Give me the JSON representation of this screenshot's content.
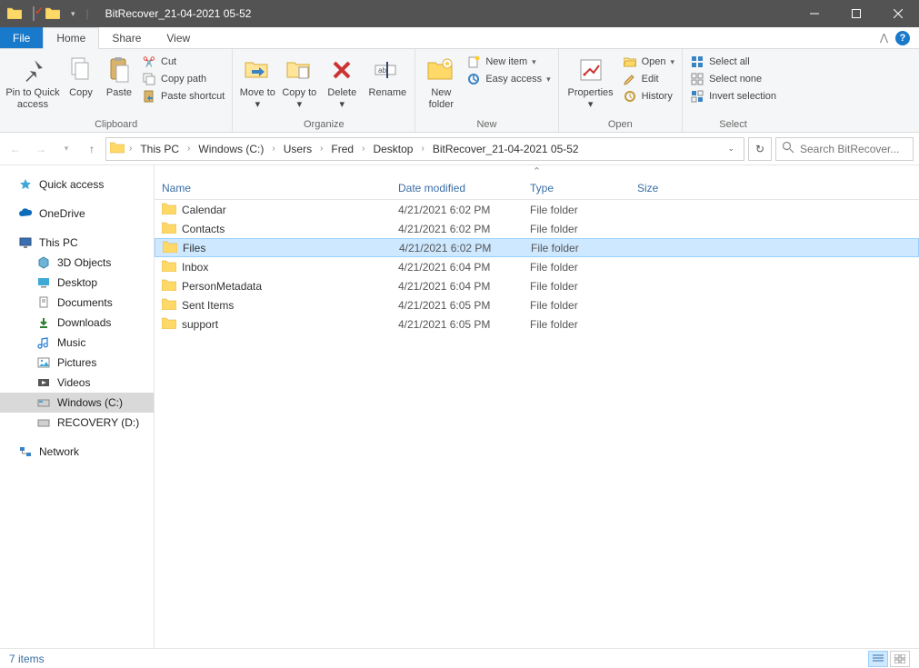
{
  "titlebar": {
    "title": "BitRecover_21-04-2021 05-52"
  },
  "tabs": {
    "file": "File",
    "home": "Home",
    "share": "Share",
    "view": "View"
  },
  "ribbon": {
    "clipboard": {
      "pin": "Pin to Quick access",
      "copy": "Copy",
      "paste": "Paste",
      "cut": "Cut",
      "copypath": "Copy path",
      "pasteshortcut": "Paste shortcut",
      "label": "Clipboard"
    },
    "organize": {
      "moveto": "Move to",
      "copyto": "Copy to",
      "delete": "Delete",
      "rename": "Rename",
      "label": "Organize"
    },
    "new": {
      "newfolder": "New folder",
      "newitem": "New item",
      "easyaccess": "Easy access",
      "label": "New"
    },
    "open": {
      "properties": "Properties",
      "open": "Open",
      "edit": "Edit",
      "history": "History",
      "label": "Open"
    },
    "select": {
      "selectall": "Select all",
      "selectnone": "Select none",
      "invert": "Invert selection",
      "label": "Select"
    }
  },
  "breadcrumbs": [
    "This PC",
    "Windows (C:)",
    "Users",
    "Fred",
    "Desktop",
    "BitRecover_21-04-2021 05-52"
  ],
  "search": {
    "placeholder": "Search BitRecover..."
  },
  "nav": {
    "quick": "Quick access",
    "onedrive": "OneDrive",
    "thispc": "This PC",
    "objects3d": "3D Objects",
    "desktop": "Desktop",
    "documents": "Documents",
    "downloads": "Downloads",
    "music": "Music",
    "pictures": "Pictures",
    "videos": "Videos",
    "windowsc": "Windows (C:)",
    "recovery": "RECOVERY (D:)",
    "network": "Network"
  },
  "columns": {
    "name": "Name",
    "date": "Date modified",
    "type": "Type",
    "size": "Size"
  },
  "rows": [
    {
      "name": "Calendar",
      "date": "4/21/2021 6:02 PM",
      "type": "File folder"
    },
    {
      "name": "Contacts",
      "date": "4/21/2021 6:02 PM",
      "type": "File folder"
    },
    {
      "name": "Files",
      "date": "4/21/2021 6:02 PM",
      "type": "File folder"
    },
    {
      "name": "Inbox",
      "date": "4/21/2021 6:04 PM",
      "type": "File folder"
    },
    {
      "name": "PersonMetadata",
      "date": "4/21/2021 6:04 PM",
      "type": "File folder"
    },
    {
      "name": "Sent Items",
      "date": "4/21/2021 6:05 PM",
      "type": "File folder"
    },
    {
      "name": "support",
      "date": "4/21/2021 6:05 PM",
      "type": "File folder"
    }
  ],
  "selected_row_index": 2,
  "status": "7 items"
}
